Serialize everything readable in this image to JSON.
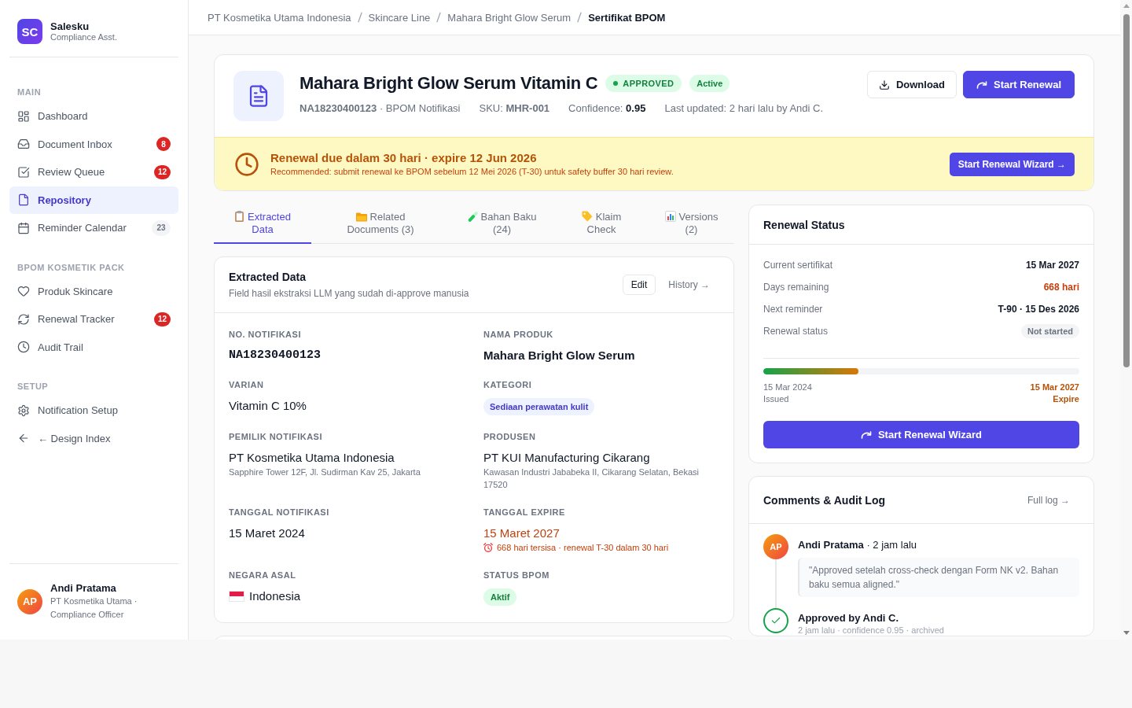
{
  "sidebar": {
    "brand": {
      "logo": "SC",
      "name": "Salesku",
      "subtitle": "Compliance Asst."
    },
    "sections": [
      {
        "title": "MAIN",
        "items": [
          {
            "label": "Dashboard",
            "selected": false
          },
          {
            "label": "Document Inbox",
            "selected": false,
            "badge": {
              "text": "8",
              "kind": "alert"
            }
          },
          {
            "label": "Review Queue",
            "selected": false,
            "badge": {
              "text": "12",
              "kind": "alert"
            }
          },
          {
            "label": "Repository",
            "selected": true
          },
          {
            "label": "Reminder Calendar",
            "selected": false,
            "badge": {
              "text": "23",
              "kind": "neutral"
            }
          }
        ]
      },
      {
        "title": "BPOM KOSMETIK PACK",
        "items": [
          {
            "label": "Produk Skincare",
            "selected": false
          },
          {
            "label": "Renewal Tracker",
            "selected": false,
            "badge": {
              "text": "12",
              "kind": "alert"
            }
          },
          {
            "label": "Audit Trail",
            "selected": false
          }
        ]
      },
      {
        "title": "SETUP",
        "items": [
          {
            "label": "Notification Setup",
            "selected": false
          },
          {
            "label": "← Design Index",
            "selected": false
          }
        ]
      }
    ],
    "user": {
      "initials": "AP",
      "name": "Andi Pratama",
      "subtitle": "PT Kosmetika Utama · Compliance Officer"
    }
  },
  "breadcrumb": [
    {
      "label": "PT Kosmetika Utama Indonesia",
      "current": false
    },
    {
      "label": "Skincare Line",
      "current": false
    },
    {
      "label": "Mahara Bright Glow Serum",
      "current": false
    },
    {
      "label": "Sertifikat BPOM",
      "current": true
    }
  ],
  "document": {
    "title": "Mahara Bright Glow Serum Vitamin C",
    "badges": [
      {
        "label": "APPROVED",
        "kind": "status"
      },
      {
        "label": "Active",
        "kind": "tag"
      }
    ],
    "meta": [
      {
        "kind": "text",
        "text": "**NA18230400123** · BPOM Notifikasi"
      },
      {
        "kind": "text",
        "text": "SKU: **MHR-001**"
      },
      {
        "kind": "score",
        "label": "Confidence:",
        "value": "0.95"
      },
      {
        "kind": "text",
        "text": "Last updated: 2 hari lalu by Andi C."
      }
    ],
    "actions": [
      {
        "label": "Download",
        "kind": "secondary"
      },
      {
        "label": "Start Renewal",
        "kind": "primary"
      }
    ],
    "banner": {
      "title": "Renewal due dalam 30 hari · expire 12 Jun 2026",
      "text": "Recommended: submit renewal ke BPOM sebelum 12 Mei 2026 (T-30) untuk safety buffer 30 hari review.",
      "action": "Start Renewal Wizard →"
    }
  },
  "tabs": [
    {
      "label": "Extracted Data",
      "selected": true
    },
    {
      "label": "Related Documents (3)",
      "selected": false
    },
    {
      "label": "Bahan Baku (24)",
      "selected": false
    },
    {
      "label": "Klaim Check",
      "selected": false
    },
    {
      "label": "Versions (2)",
      "selected": false
    }
  ],
  "extracted_data": {
    "title": "Extracted Data",
    "subtitle": "Field hasil ekstraksi LLM yang sudah di-approve manusia",
    "edit": "Edit",
    "history": "History →",
    "fields": [
      {
        "label": "NO. NOTIFIKASI",
        "value": "NA18230400123",
        "kind": "id"
      },
      {
        "label": "NAMA PRODUK",
        "value": "Mahara Bright Glow Serum",
        "kind": "strong"
      },
      {
        "label": "VARIAN",
        "value": "Vitamin C 10%",
        "kind": "text"
      },
      {
        "label": "KATEGORI",
        "value": "Sediaan perawatan kulit",
        "kind": "category"
      },
      {
        "label": "PEMILIK NOTIFIKASI",
        "value": "PT Kosmetika Utama Indonesia",
        "kind": "text",
        "note": "Sapphire Tower 12F, Jl. Sudirman Kav 25, Jakarta"
      },
      {
        "label": "PRODUSEN",
        "value": "PT KUI Manufacturing Cikarang",
        "kind": "text",
        "note": "Kawasan Industri Jababeka II, Cikarang Selatan, Bekasi 17520"
      },
      {
        "label": "TANGGAL NOTIFIKASI",
        "value": "15 Maret 2024",
        "kind": "text"
      },
      {
        "label": "TANGGAL EXPIRE",
        "value": "15 Maret 2027",
        "kind": "warning",
        "note": "668 hari tersisa · renewal T-30 dalam 30 hari"
      },
      {
        "label": "NEGARA ASAL",
        "value": "Indonesia",
        "kind": "country"
      },
      {
        "label": "STATUS BPOM",
        "value": "Aktif",
        "kind": "status"
      }
    ]
  },
  "renewal": {
    "title": "Renewal Status",
    "rows": [
      {
        "label": "Current sertifikat",
        "value": "15 Mar 2027",
        "kind": "plain"
      },
      {
        "label": "Days remaining",
        "value": "668 hari",
        "kind": "warning"
      },
      {
        "label": "Next reminder",
        "value": "T-90 · 15 Des 2026",
        "kind": "plain"
      },
      {
        "label": "Renewal status",
        "value": "Not started",
        "kind": "pill"
      }
    ],
    "progress": {
      "level": 0.3,
      "start": {
        "date": "15 Mar 2024",
        "label": "Issued"
      },
      "end": {
        "date": "15 Mar 2027",
        "label": "Expire"
      }
    },
    "action": "Start Renewal Wizard"
  },
  "comments": {
    "title": "Comments & Audit Log",
    "link": "Full log →",
    "entries": [
      {
        "kind": "comment",
        "initials": "AP",
        "heading": "**Andi Pratama** · 2 jam lalu",
        "text": "\"Approved setelah cross-check dengan Form NK v2. Bahan baku semua aligned.\""
      },
      {
        "kind": "approval",
        "heading": "Approved by Andi C.",
        "text": "2 jam lalu · confidence 0.95 · archived"
      }
    ]
  }
}
